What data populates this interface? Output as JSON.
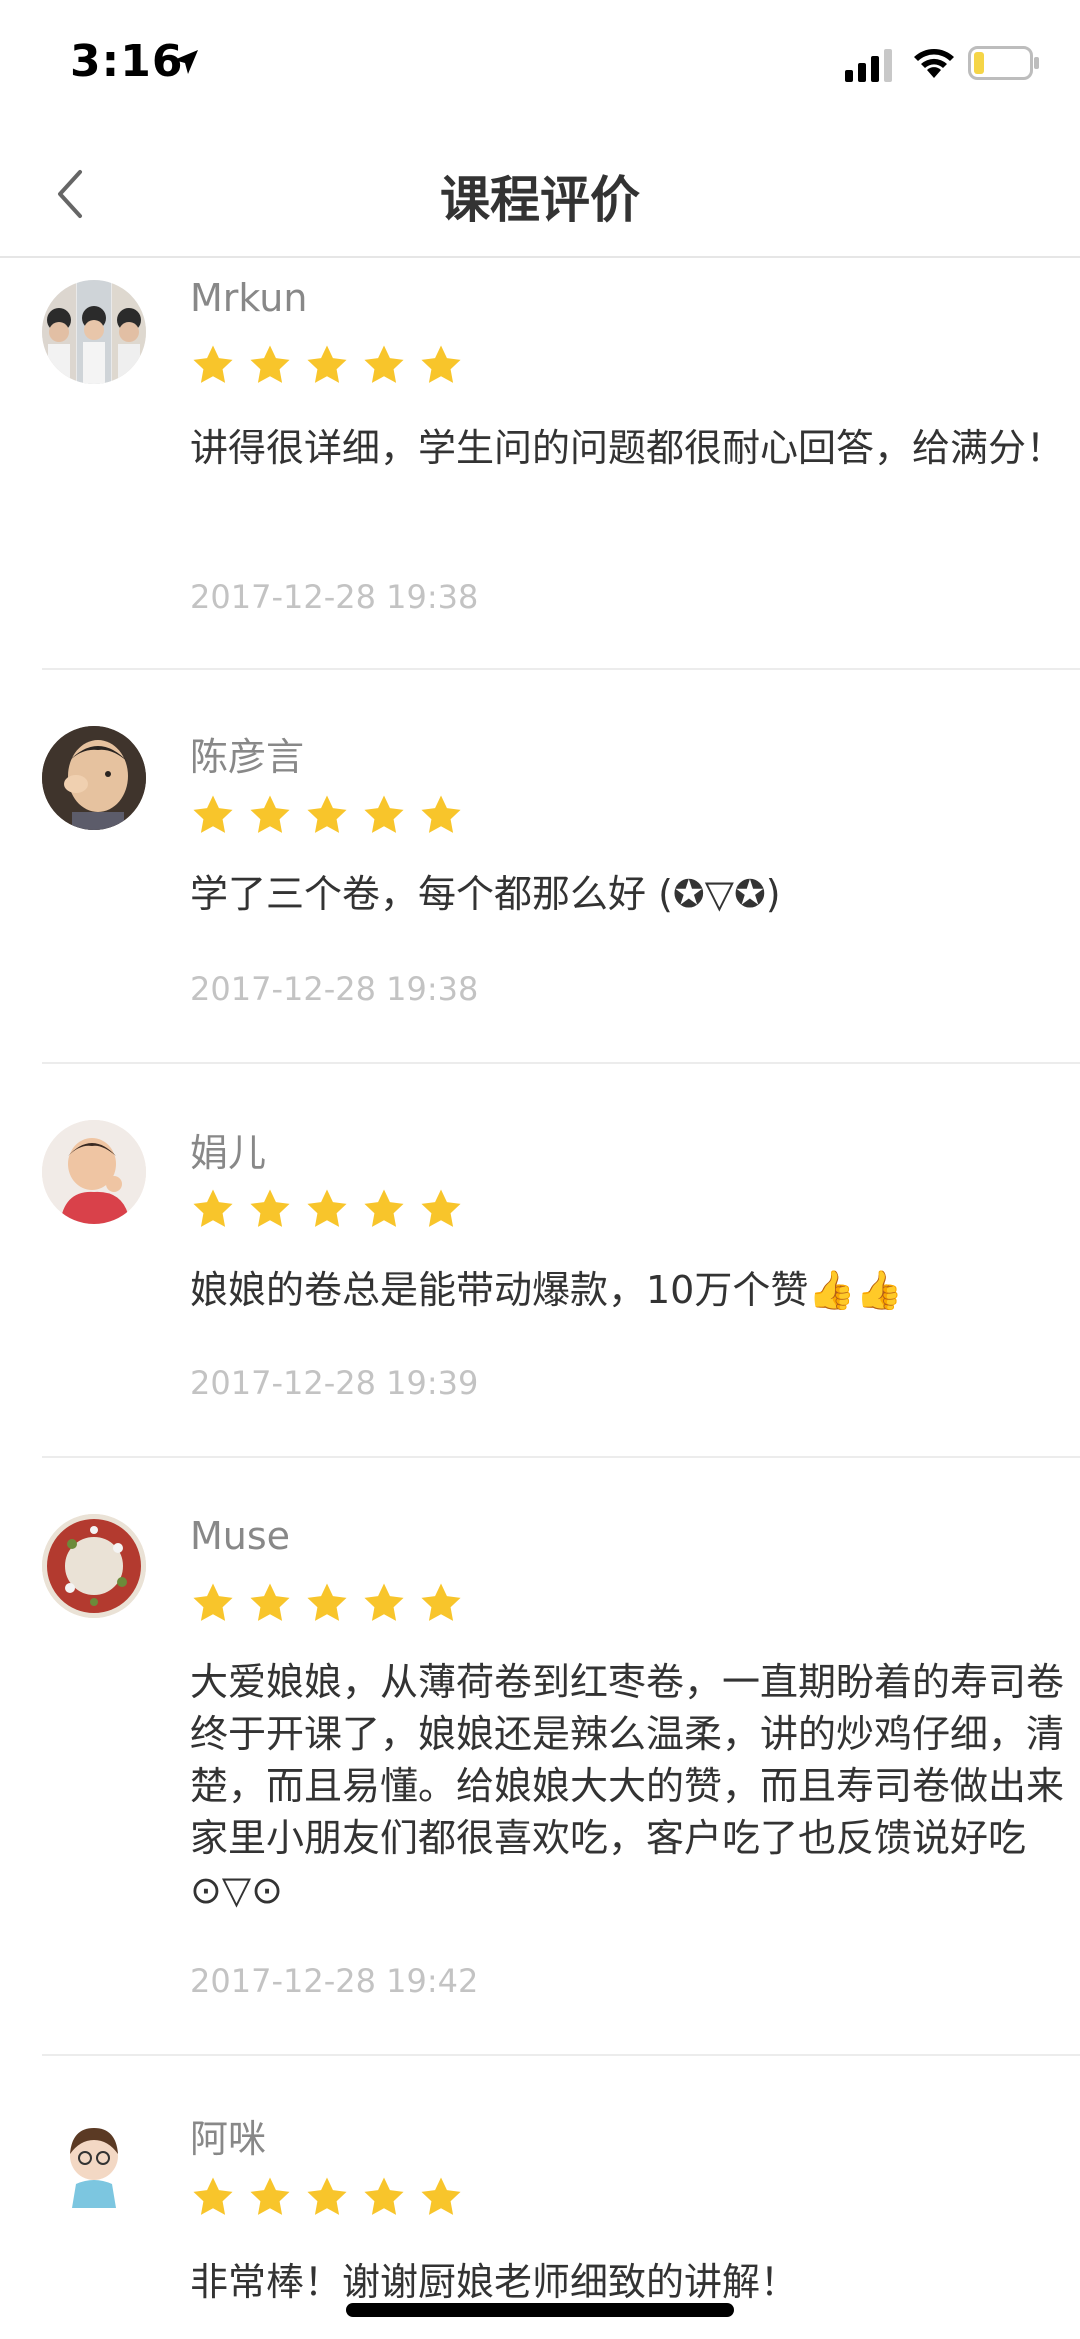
{
  "status": {
    "time": "3:16"
  },
  "nav": {
    "title": "课程评价"
  },
  "colors": {
    "star": "#F8C52B",
    "date": "#C3C3C3",
    "name": "#888888"
  },
  "reviews": [
    {
      "name": "Mrkun",
      "rating": 5,
      "text": "讲得很详细，学生问的问题都很耐心回答，给满分！",
      "date": "2017-12-28 19:38"
    },
    {
      "name": "陈彦言",
      "rating": 5,
      "text": "学了三个卷，每个都那么好 (✪▽✪)",
      "date": "2017-12-28 19:38"
    },
    {
      "name": "娟儿",
      "rating": 5,
      "text": "娘娘的卷总是能带动爆款，10万个赞👍👍",
      "date": "2017-12-28 19:39"
    },
    {
      "name": "Muse",
      "rating": 5,
      "text": "大爱娘娘，从薄荷卷到红枣卷，一直期盼着的寿司卷终于开课了，娘娘还是辣么温柔，讲的炒鸡仔细，清楚，而且易懂。给娘娘大大的赞，而且寿司卷做出来家里小朋友们都很喜欢吃，客户吃了也反馈说好吃⊙▽⊙",
      "date": "2017-12-28 19:42"
    },
    {
      "name": "阿咪",
      "rating": 5,
      "text": "非常棒！谢谢厨娘老师细致的讲解！",
      "date": ""
    }
  ]
}
